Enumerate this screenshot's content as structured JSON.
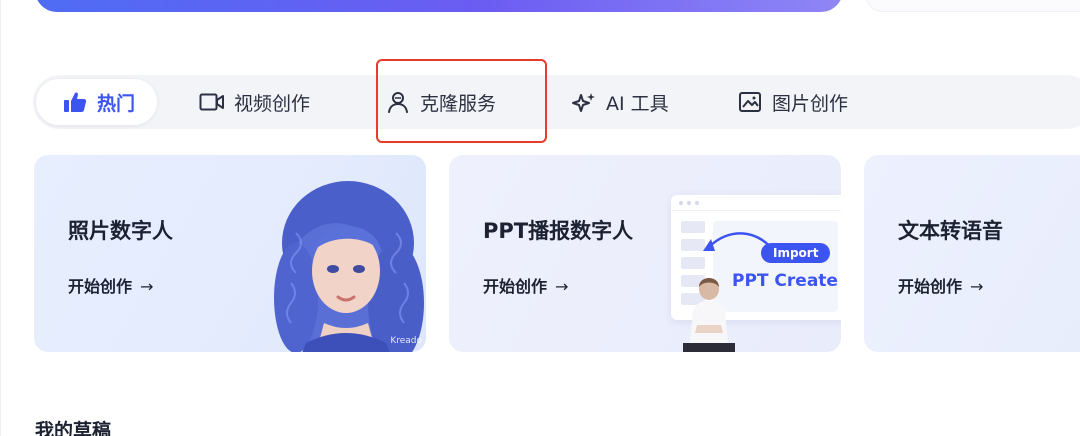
{
  "tabs": [
    {
      "label": "热门",
      "icon": "thumbs-up-icon",
      "active": true
    },
    {
      "label": "视频创作",
      "icon": "video-camera-icon",
      "active": false
    },
    {
      "label": "克隆服务",
      "icon": "user-clone-icon",
      "active": false
    },
    {
      "label": "AI 工具",
      "icon": "sparkle-icon",
      "active": false
    },
    {
      "label": "图片创作",
      "icon": "image-icon",
      "active": false
    }
  ],
  "cards": [
    {
      "title": "照片数字人",
      "cta": "开始创作",
      "brand": "Kreado"
    },
    {
      "title": "PPT播报数字人",
      "cta": "开始创作",
      "import_label": "Import",
      "ppt_label": "PPT Create"
    },
    {
      "title": "文本转语音",
      "cta": "开始创作"
    }
  ],
  "section": {
    "drafts_title": "我的草稿"
  },
  "colors": {
    "accent": "#3d55f0",
    "highlight": "#e53c2c",
    "banner": "#5a64f3"
  }
}
